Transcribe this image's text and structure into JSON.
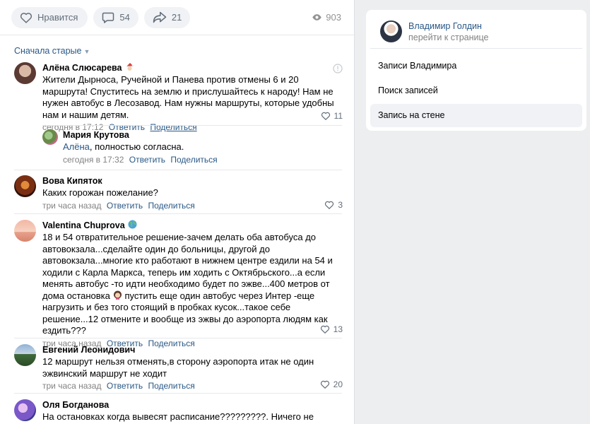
{
  "post_actions": {
    "like_label": "Нравится",
    "comments_count": "54",
    "shares_count": "21",
    "views_count": "903"
  },
  "sort": {
    "label": "Сначала старые"
  },
  "comments": [
    {
      "author": "Алёна Слюсарева",
      "text": "Жители Дырноса, Ручейной и Панева против отмены 6 и 20 маршрута! Спуститесь на землю и прислушайтесь к народу! Нам не нужен автобус в Лесозавод. Нам нужны маршруты, которые удобны нам и нашим детям.",
      "time": "сегодня в 17:12",
      "reply": "Ответить",
      "share": "Поделиться",
      "likes": "11"
    },
    {
      "author": "Мария Крутова",
      "mention": "Алёна",
      "text": ", полностью согласна.",
      "time": "сегодня в 17:32",
      "reply": "Ответить",
      "share": "Поделиться"
    },
    {
      "author": "Вова Кипяток",
      "text": "Каких горожан пожелание?",
      "time": "три часа назад",
      "reply": "Ответить",
      "share": "Поделиться",
      "likes": "3"
    },
    {
      "author": "Valentina Chuprova",
      "text_a": "18 и 54 отвратительное решение-зачем делать оба автобуса до автовокзала...сделайте один до больницы, другой до автовокзала...многие кто работают в нижнем центре ездили на 54 и ходили с Карла Маркса, теперь им ходить с Октябрьского...а если менять автобус -то идти необходимо будет по эжве...400 метров от дома остановка",
      "text_b": " пустить еще один автобус через Интер -еще нагрузить и без того стоящий в пробках кусок...такое себе решение...12 отмените и вообще из эжвы до аэропорта людям как ездить???",
      "time": "три часа назад",
      "reply": "Ответить",
      "share": "Поделиться",
      "likes": "13"
    },
    {
      "author": "Евгений Леонидович",
      "text": "12 маршрут нельзя отменять,в сторону аэропорта итак не один эжвинский маршрут не ходит",
      "time": "три часа назад",
      "reply": "Ответить",
      "share": "Поделиться",
      "likes": "20"
    },
    {
      "author": "Оля Богданова",
      "text": "На остановках когда вывесят расписание?????????. Ничего не понятно. До"
    }
  ],
  "sidebar": {
    "profile_name": "Владимир Голдин",
    "profile_link": "перейти к странице",
    "items": [
      "Записи Владимира",
      "Поиск записей",
      "Запись на стене"
    ]
  },
  "colors": {
    "link": "#2a5885",
    "meta": "#828282",
    "page_bg": "#edeef0"
  }
}
